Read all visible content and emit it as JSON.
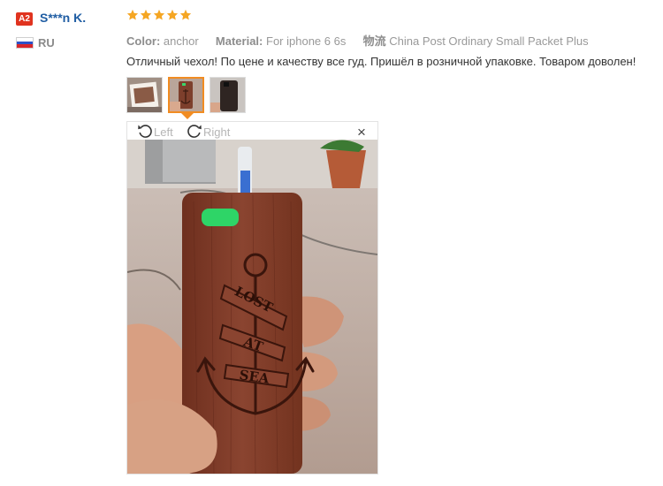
{
  "user": {
    "level": "A2",
    "name": "S***n K.",
    "country": "RU",
    "flag_colors": [
      "#ffffff",
      "#2b51c8",
      "#d8262b"
    ]
  },
  "review": {
    "rating": 5,
    "star_color": "#f5a623",
    "attributes": [
      {
        "key": "Color:",
        "value": "anchor"
      },
      {
        "key": "Material:",
        "value": "For iphone 6 6s"
      },
      {
        "key": "物流",
        "value": "China Post Ordinary Small Packet Plus"
      }
    ],
    "text": "Отличный чехол! По цене и качеству все гуд. Пришёл в розничной упаковке. Товаром доволен!"
  },
  "thumbnails": [
    {
      "name": "photo-1",
      "active": false
    },
    {
      "name": "photo-2",
      "active": true
    },
    {
      "name": "photo-3",
      "active": false
    }
  ],
  "viewer": {
    "rotate_left_label": "Left",
    "rotate_right_label": "Right",
    "close_symbol": "×",
    "engraving": [
      "LOST",
      "AT",
      "SEA"
    ]
  },
  "colors": {
    "accent": "#f18c22",
    "username": "#1f5da3",
    "badge": "#e0331f"
  }
}
